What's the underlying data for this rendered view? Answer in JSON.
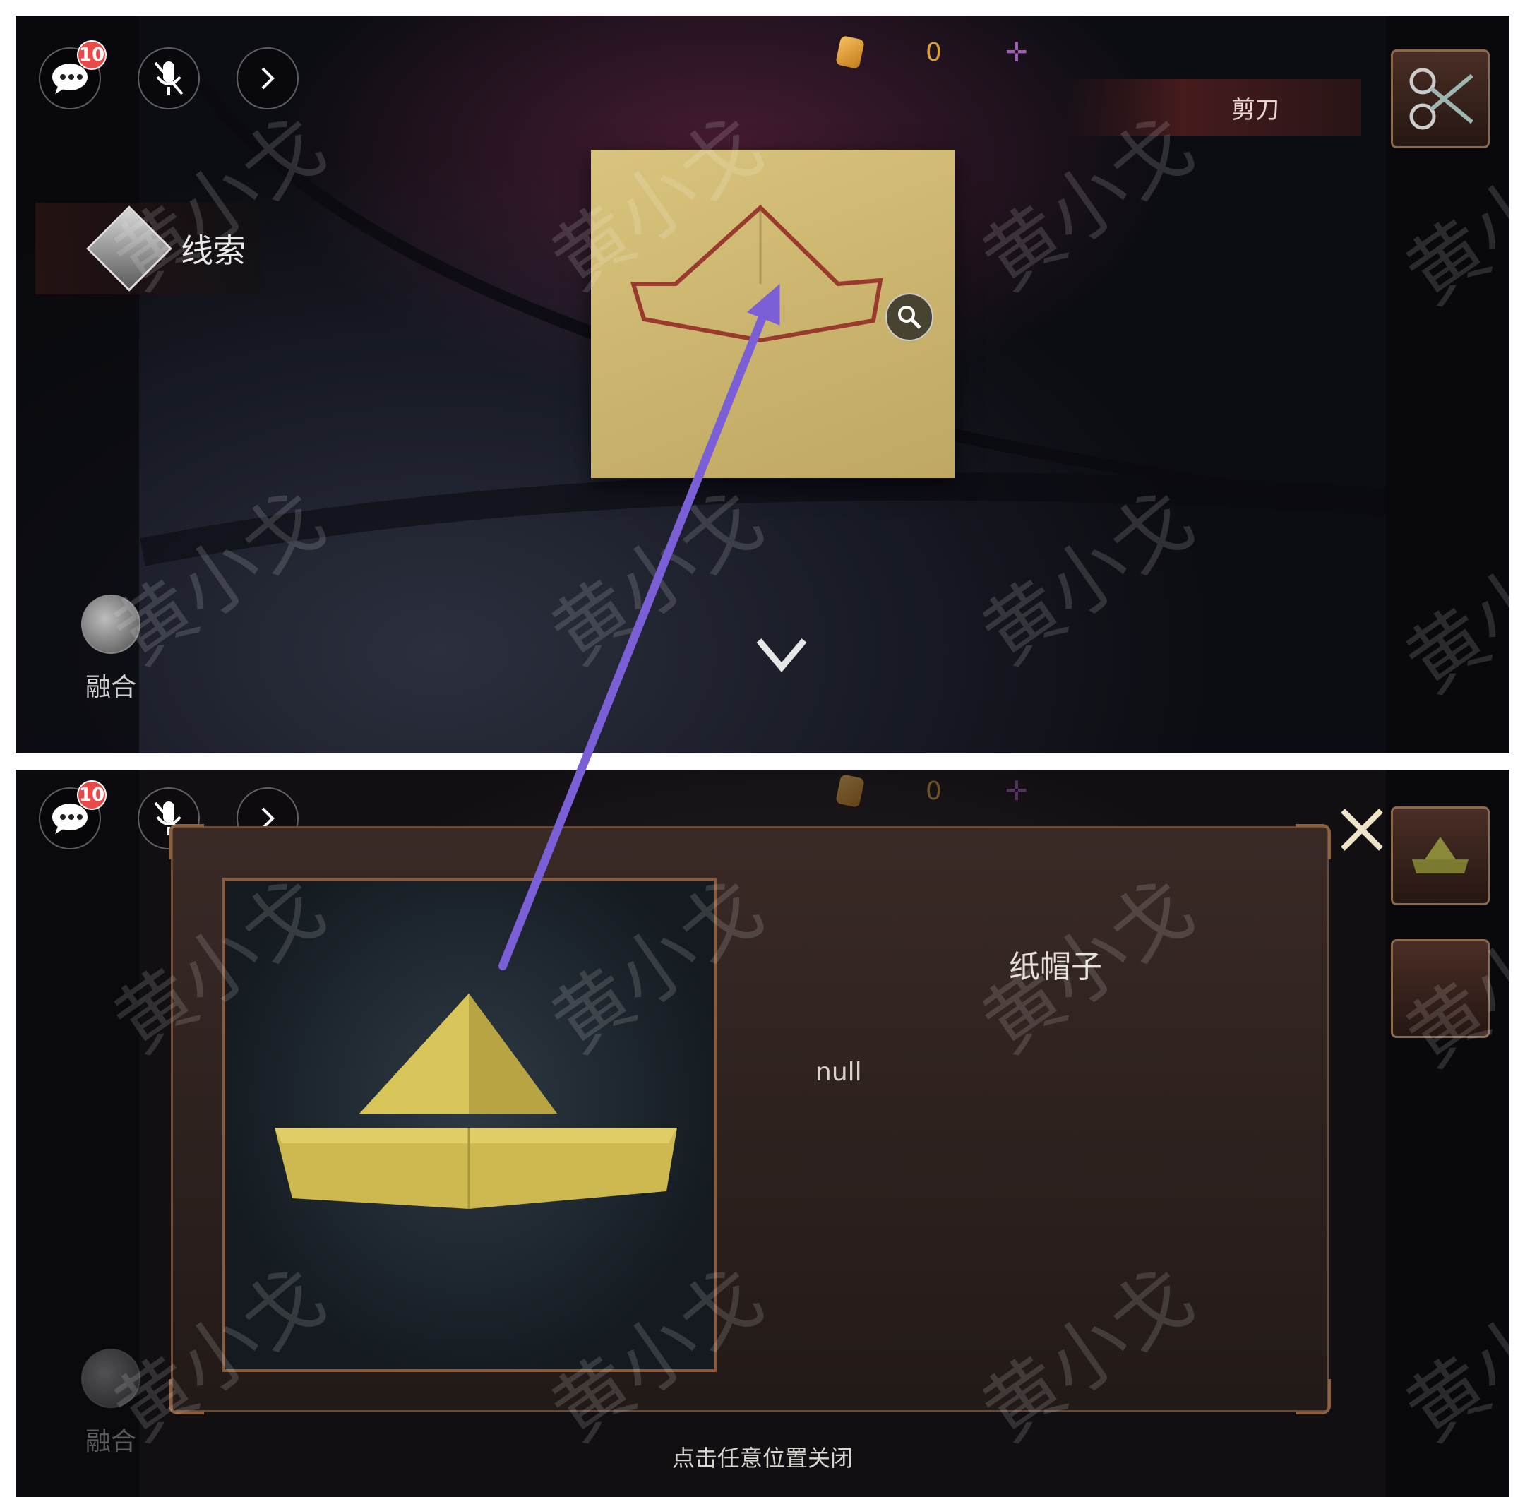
{
  "top_screen": {
    "chat_badge_count": "10",
    "currency_value": "0",
    "clue_tab_label": "线索",
    "fuse_label": "融合",
    "item_tip_label": "剪刀",
    "icons": {
      "chat": "chat-bubble-icon",
      "mic": "mic-muted-icon",
      "expand": "chevron-right-icon",
      "coin": "coin-icon",
      "add": "plus-icon",
      "clue": "clue-diamond-icon",
      "fuse": "fuse-swirl-icon",
      "scissors": "scissors-icon",
      "magnifier": "magnifier-icon",
      "collapse": "chevron-down-icon"
    }
  },
  "bottom_screen": {
    "chat_badge_count": "10",
    "currency_value": "0",
    "fuse_label": "融合",
    "item_title": "纸帽子",
    "item_description": "null",
    "close_hint": "点击任意位置关闭"
  },
  "watermark_text": "黄小戈",
  "colors": {
    "annotation_arrow": "#7b5fd6",
    "badge": "#e84a4a",
    "paper": "#d3be78",
    "dialog_border": "#8a5a3a"
  }
}
